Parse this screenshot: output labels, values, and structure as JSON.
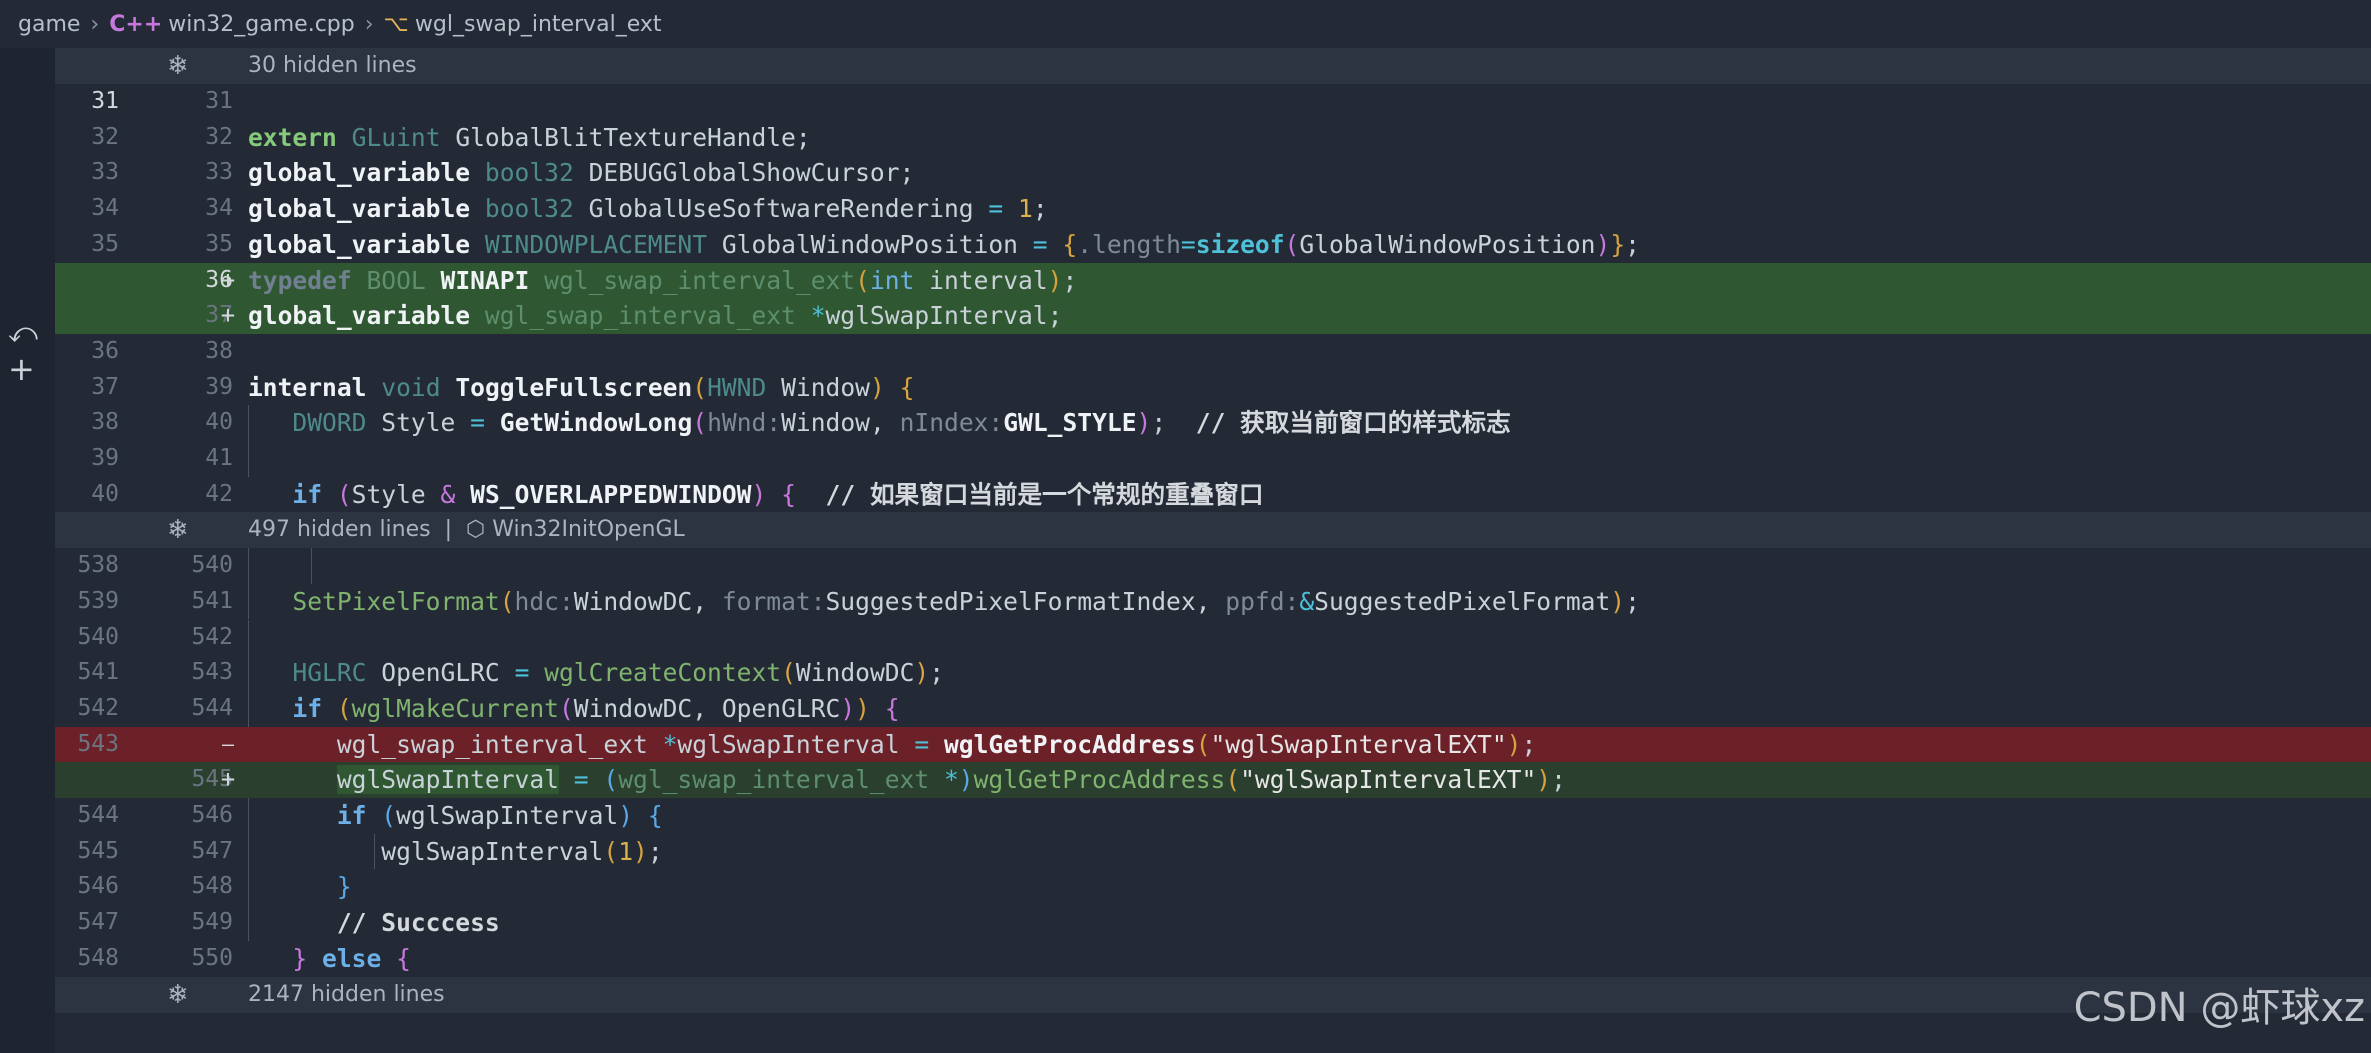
{
  "breadcrumb": {
    "root": "game",
    "file_icon": "C++",
    "file": "win32_game.cpp",
    "symbol": "wgl_swap_interval_ext"
  },
  "folds": [
    {
      "text": "30 hidden lines"
    },
    {
      "text": "497 hidden lines",
      "context": "Win32InitOpenGL"
    },
    {
      "text": "2147 hidden lines"
    }
  ],
  "lines": [
    {
      "old": "31",
      "new": "31"
    },
    {
      "old": "32",
      "new": "32"
    },
    {
      "old": "33",
      "new": "33"
    },
    {
      "old": "34",
      "new": "34"
    },
    {
      "old": "35",
      "new": "35"
    },
    {
      "old": "",
      "new": "36",
      "marker": "+"
    },
    {
      "old": "",
      "new": "37",
      "marker": "+"
    },
    {
      "old": "36",
      "new": "38"
    },
    {
      "old": "37",
      "new": "39"
    },
    {
      "old": "38",
      "new": "40"
    },
    {
      "old": "39",
      "new": "41"
    },
    {
      "old": "40",
      "new": "42"
    },
    {
      "old": "538",
      "new": "540"
    },
    {
      "old": "539",
      "new": "541"
    },
    {
      "old": "540",
      "new": "542"
    },
    {
      "old": "541",
      "new": "543"
    },
    {
      "old": "542",
      "new": "544"
    },
    {
      "old": "543",
      "new": "",
      "marker": "—"
    },
    {
      "old": "",
      "new": "545",
      "marker": "+"
    },
    {
      "old": "544",
      "new": "546"
    },
    {
      "old": "545",
      "new": "547"
    },
    {
      "old": "546",
      "new": "548"
    },
    {
      "old": "547",
      "new": "549"
    },
    {
      "old": "548",
      "new": "550"
    }
  ],
  "colors": {
    "added": "#2f5731",
    "removed": "#6b2127",
    "background": "#232a36"
  },
  "icons": [
    "revert-icon",
    "add-icon",
    "unfold-icon",
    "cube-icon"
  ],
  "watermark": "CSDN @虾球xz"
}
